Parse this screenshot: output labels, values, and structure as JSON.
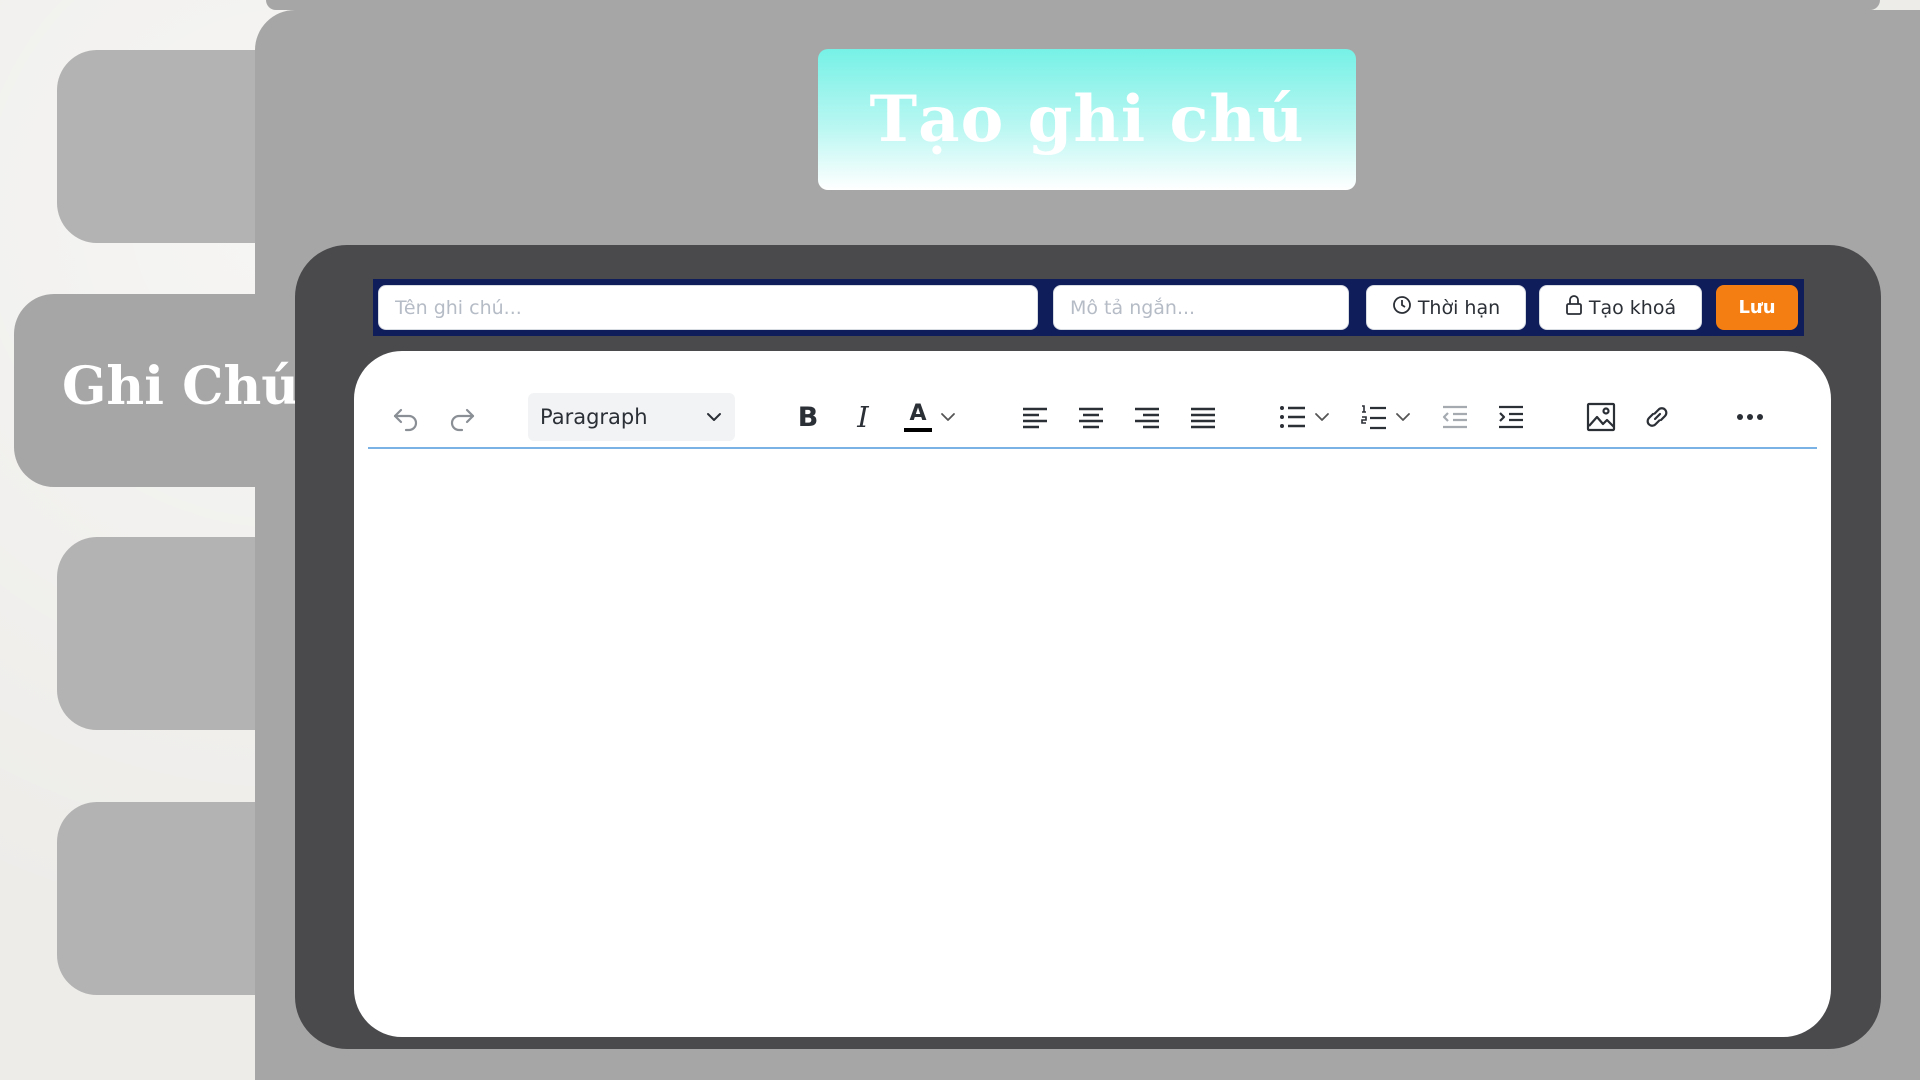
{
  "app": {
    "banner_title": "Tạo ghi chú",
    "sidebar_active_label": "Ghi Chú"
  },
  "form": {
    "title_placeholder": "Tên ghi chú...",
    "title_value": "",
    "description_placeholder": "Mô tả ngắn...",
    "description_value": "",
    "deadline_label": "Thời hạn",
    "lock_label": "Tạo khoá",
    "save_label": "Lưu"
  },
  "editor": {
    "block_format": "Paragraph",
    "text_color": "#000000",
    "content": ""
  },
  "icons": {
    "undo": "undo-icon",
    "redo": "redo-icon",
    "deadline": "clock-icon",
    "lock": "lock-icon",
    "more": "ellipsis-icon"
  },
  "colors": {
    "background": "#edece9",
    "panel": "#a6a6a6",
    "editor_frame": "#4a4a4d",
    "form_bar": "#0f1d5a",
    "save_accent": "#f57e12",
    "banner_gradient_top": "#76f1e6",
    "toolbar_underline": "#7ab2e5"
  }
}
